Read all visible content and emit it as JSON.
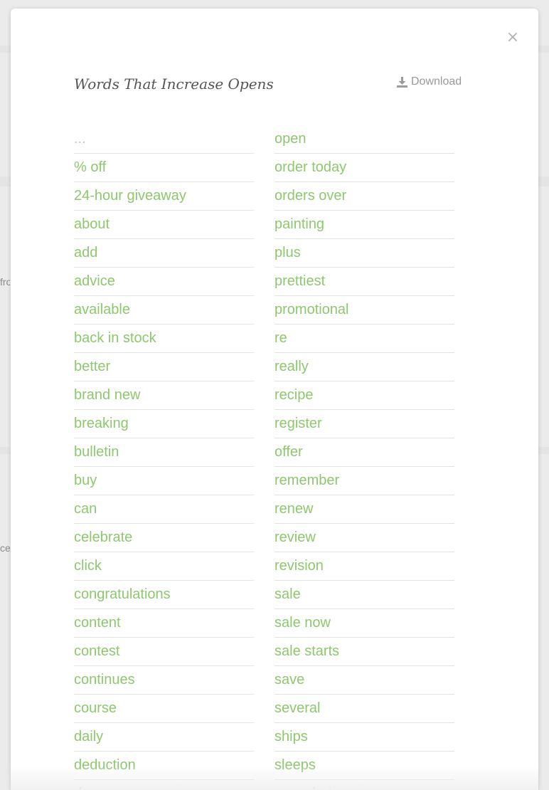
{
  "modal": {
    "title": "Words That Increase Opens",
    "download_label": "Download",
    "close_glyph": "×"
  },
  "background": {
    "fragment_1": "fro",
    "fragment_2": "ce"
  },
  "words": {
    "left": [
      "...",
      "% off",
      "24-hour giveaway",
      "about",
      "add",
      "advice",
      "available",
      "back in stock",
      "better",
      "brand new",
      "breaking",
      "bulletin",
      "buy",
      "can",
      "celebrate",
      "click",
      "congratulations",
      "content",
      "contest",
      "continues",
      "course",
      "daily",
      "deduction",
      "deserve"
    ],
    "right": [
      "open",
      "order today",
      "orders over",
      "painting",
      "plus",
      "prettiest",
      "promotional",
      "re",
      "really",
      "recipe",
      "register",
      "offer",
      "remember",
      "renew",
      "review",
      "revision",
      "sale",
      "sale now",
      "sale starts",
      "save",
      "several",
      "ships",
      "sleeps",
      "snapshot"
    ]
  },
  "colors": {
    "word_green": "#8dc86e",
    "muted_gray": "#c9c9c9",
    "divider": "#e2e2e2"
  },
  "icons": {
    "download": "download-icon",
    "close": "close-icon"
  }
}
